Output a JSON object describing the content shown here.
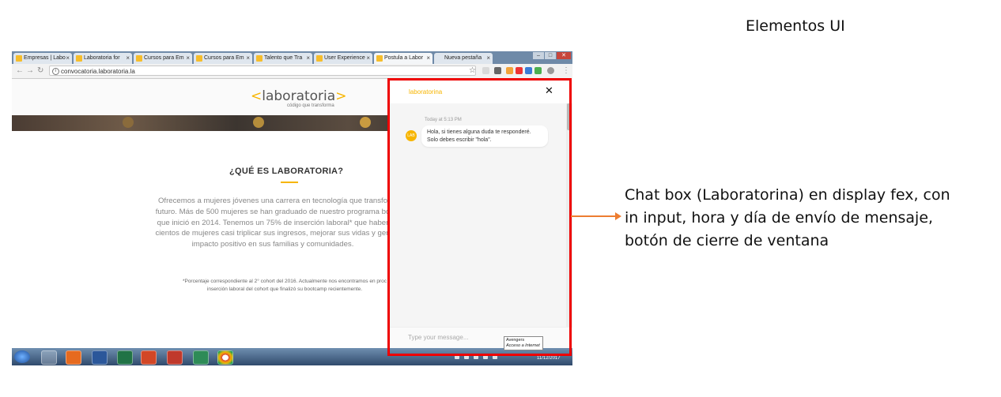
{
  "slide": {
    "title": "Elementos UI",
    "annotation": "Chat box (Laboratorina) en display fex, con in input, hora y día de envío de mensaje, botón de cierre de ventana"
  },
  "browser": {
    "tabs": [
      {
        "label": "Empresas | Labo",
        "active": false
      },
      {
        "label": "Laboratoria for",
        "active": false
      },
      {
        "label": "Cursos para Em",
        "active": false
      },
      {
        "label": "Cursos para Em",
        "active": false
      },
      {
        "label": "Talento que Tra",
        "active": false
      },
      {
        "label": "User Experience",
        "active": false
      },
      {
        "label": "Postula a Labor",
        "active": true
      },
      {
        "label": "Nueva pestaña",
        "active": false
      }
    ],
    "url": "convocatoria.laboratoria.la"
  },
  "page": {
    "logo_left": "<",
    "logo_text": "laboratoria",
    "logo_right": ">",
    "tagline": "código que transforma",
    "section_title": "¿QUÉ ES LABORATORIA?",
    "paragraph_lines": [
      "Ofrecemos a mujeres jóvenes una carrera en tecnología que transfo",
      "futuro. Más de 500 mujeres se han graduado de nuestro programa bo",
      "que inició en 2014. Tenemos un 75% de inserción laboral* que haber",
      "cientos de mujeres casi triplicar sus ingresos, mejorar sus vidas y gen",
      "impacto positivo en sus familias y comunidades."
    ],
    "note_lines": [
      "*Porcentaje correspondiente al 2° cohort del 2016. Actualmente nos encontramos en proc",
      "inserción laboral del cohort que finalizó su bootcamp recientemente."
    ]
  },
  "chat": {
    "name": "laboratorina",
    "close_icon": "close-icon",
    "timestamp": "Today at 5:13 PM",
    "avatar_text": "LAB",
    "message_line1": "Hola, si tienes alguna duda te responderé.",
    "message_line2": "Solo debes escribir \"hola\".",
    "input_placeholder": "Type your message...",
    "tooltip_line1": "Avengers",
    "tooltip_line2": "Acceso a Internet"
  },
  "taskbar": {
    "clock_date": "11/12/2017"
  },
  "colors": {
    "brand_yellow": "#f7b500",
    "highlight_red": "#ee0000",
    "arrow_orange": "#ed7d31"
  }
}
